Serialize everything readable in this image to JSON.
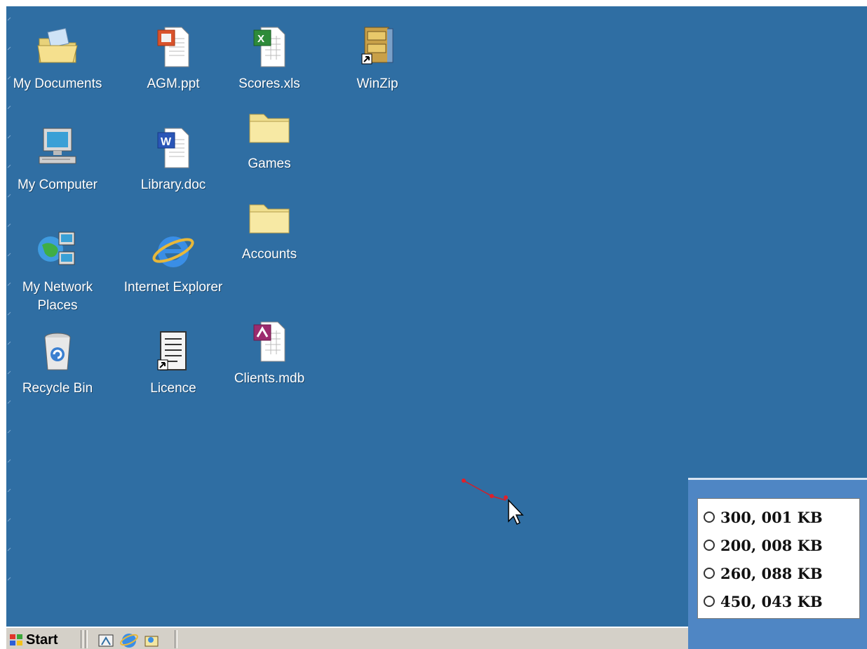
{
  "desktop": {
    "background_color": "#2f6ea3",
    "icons": [
      {
        "id": "my-documents",
        "label": "My Documents",
        "icon": "folder-documents-icon"
      },
      {
        "id": "agm-ppt",
        "label": "AGM.ppt",
        "icon": "powerpoint-file-icon"
      },
      {
        "id": "scores-xls",
        "label": "Scores.xls",
        "icon": "excel-file-icon"
      },
      {
        "id": "winzip",
        "label": "WinZip",
        "icon": "winzip-shortcut-icon"
      },
      {
        "id": "my-computer",
        "label": "My Computer",
        "icon": "computer-icon"
      },
      {
        "id": "library-doc",
        "label": "Library.doc",
        "icon": "word-file-icon"
      },
      {
        "id": "games",
        "label": "Games",
        "icon": "folder-icon"
      },
      {
        "id": "accounts",
        "label": "Accounts",
        "icon": "folder-icon"
      },
      {
        "id": "my-network-places",
        "label": "My Network Places",
        "icon": "network-icon"
      },
      {
        "id": "internet-explorer",
        "label": "Internet Explorer",
        "icon": "internet-explorer-icon"
      },
      {
        "id": "clients-mdb",
        "label": "Clients.mdb",
        "icon": "access-file-icon"
      },
      {
        "id": "recycle-bin",
        "label": "Recycle Bin",
        "icon": "recycle-bin-icon"
      },
      {
        "id": "licence",
        "label": "Licence",
        "icon": "text-document-shortcut-icon"
      }
    ]
  },
  "taskbar": {
    "start_label": "Start",
    "quick_launch": [
      "show-desktop-icon",
      "internet-explorer-icon",
      "outlook-icon"
    ]
  },
  "quiz": {
    "options": [
      {
        "label": "300, 001 KB"
      },
      {
        "label": "200, 008 KB"
      },
      {
        "label": "260, 088 KB"
      },
      {
        "label": "450, 043 KB"
      }
    ]
  }
}
